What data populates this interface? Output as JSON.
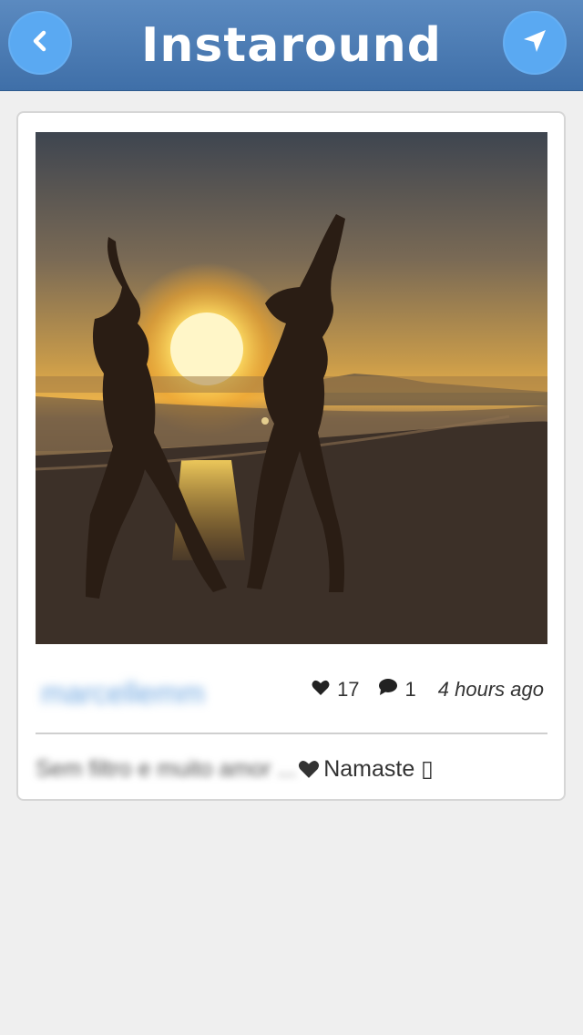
{
  "app": {
    "title": "Instaround"
  },
  "navbar": {
    "back_icon": "chevron-left-icon",
    "location_icon": "location-arrow-icon",
    "accent_color": "#5aa9f2",
    "bar_color": "#4a7bb4"
  },
  "post": {
    "photo_description_icon": "sunset-beach-photo",
    "username": "marcellemm",
    "likes": "17",
    "comments": "1",
    "time_ago": "4 hours ago",
    "caption_prefix": "Sem filtro e muito amor ...",
    "caption_suffix": "Namaste ▯",
    "like_icon": "heart-icon",
    "comment_icon": "speech-bubble-icon"
  }
}
